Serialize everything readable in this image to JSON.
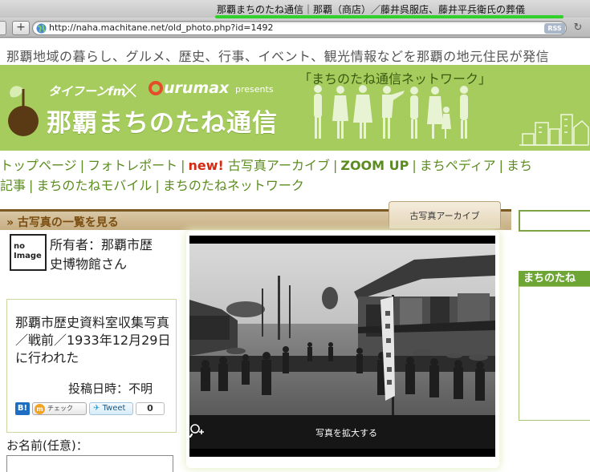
{
  "window": {
    "title": "那覇まちのたね通信｜那覇（商店）／藤井呉服店、藤井平兵衛氏の葬儀"
  },
  "toolbar": {
    "plus_label": "+",
    "url": "http://naha.machitane.net/old_photo.php?id=1492",
    "rss_label": "RSS",
    "reload_icon": "reload-icon"
  },
  "site": {
    "tagline": "那覇地域の暮らし、グルメ、歴史、行事、イベント、観光情報などを那覇の地元住民が発信",
    "catch": "「まちのたね通信ネットワーク」",
    "logo1": "タイフーンfm",
    "logo2_rest": "urumax",
    "presents": "presents",
    "title": "那覇まちのたね通信"
  },
  "nav": {
    "row1": [
      "トップページ",
      "フォトレポート",
      "古写真アーカイブ",
      "ZOOM UP",
      "まちペディア",
      "まち"
    ],
    "new_badge": "new!",
    "row2": [
      "記事",
      "まちのたねモバイル",
      "まちのたねネットワーク"
    ],
    "separator": "|"
  },
  "section": {
    "back_link": "» 古写真の一覧を見る",
    "tab_label": "古写真アーカイブ"
  },
  "sidebar": {
    "heading": "まちのたね"
  },
  "owner": {
    "avatar_text": [
      "no",
      "Image"
    ],
    "label": "所有者：那覇市歴史博物館さん"
  },
  "description": {
    "text": "那覇市歴史資料室収集写真／戦前／1933年12月29日に行われた",
    "posted": "投稿日時：不明"
  },
  "share": {
    "hatena": "B!",
    "mixi_mark": "m",
    "check": "チェック",
    "tweet": "Tweet",
    "tweet_count": "0"
  },
  "photo": {
    "zoom_label": "写真を拡大する",
    "zoom_icon": "zoom-in-icon"
  },
  "form": {
    "name_label": "お名前(任意)："
  }
}
